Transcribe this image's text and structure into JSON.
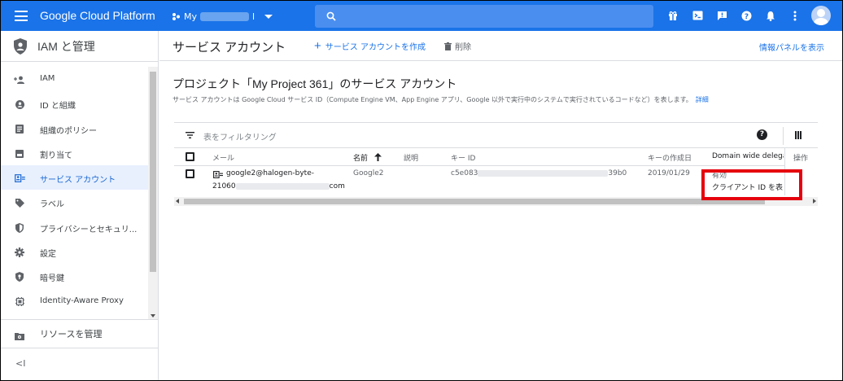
{
  "topbar": {
    "brand": "Google Cloud Platform",
    "project_prefix": "My",
    "project_suffix": "l",
    "icons": [
      "gift-icon",
      "cloud-shell-icon",
      "feedback-icon",
      "help-icon",
      "notifications-icon",
      "more-icon"
    ]
  },
  "sidebar": {
    "title": "IAM と管理",
    "items": [
      {
        "label": "IAM",
        "icon": "add-person-icon"
      },
      {
        "label": "ID と組織",
        "icon": "account-circle-icon"
      },
      {
        "label": "組織のポリシー",
        "icon": "policy-doc-icon"
      },
      {
        "label": "割り当て",
        "icon": "quota-icon"
      },
      {
        "label": "サービス アカウント",
        "icon": "service-account-icon",
        "active": true
      },
      {
        "label": "ラベル",
        "icon": "label-icon"
      },
      {
        "label": "プライバシーとセキュリ...",
        "icon": "privacy-shield-icon"
      },
      {
        "label": "設定",
        "icon": "gear-icon"
      },
      {
        "label": "暗号鍵",
        "icon": "crypto-key-shield-icon"
      },
      {
        "label": "Identity-Aware Proxy",
        "icon": "iap-icon"
      }
    ],
    "manage_resources": "リソースを管理",
    "collapse": "<I"
  },
  "toolbar": {
    "page_title": "サービス アカウント",
    "create_label": "サービス アカウントを作成",
    "delete_label": "削除",
    "info_panel": "情報パネルを表示"
  },
  "section": {
    "title": "プロジェクト「My Project 361」のサービス アカウント",
    "description": "サービス アカウントは Google Cloud サービス ID（Compute Engine VM、App Engine アプリ、Google 以外で実行中のシステムで実行されているコードなど）を表します。",
    "details_link": "詳細"
  },
  "filter": {
    "placeholder": "表をフィルタリング",
    "help": "?"
  },
  "table": {
    "headers": {
      "email": "メール",
      "name": "名前",
      "description": "説明",
      "key_id": "キー ID",
      "key_created": "キーの作成日",
      "domain_delegation": "Domain wide delegati",
      "actions": "操作"
    },
    "rows": [
      {
        "email_line1": "google2@halogen-byte-",
        "email_line2_prefix": "21060",
        "email_line2_suffix": "com",
        "name": "Google2",
        "key_id_prefix": "c5e083",
        "key_id_suffix": "39b0",
        "key_created": "2019/01/29",
        "delegation_status": "有効",
        "delegation_link": "クライアント ID を表"
      }
    ]
  },
  "colors": {
    "accent": "#1a73e8",
    "highlight": "#e5000d",
    "active_bg": "#e8f0fe"
  }
}
